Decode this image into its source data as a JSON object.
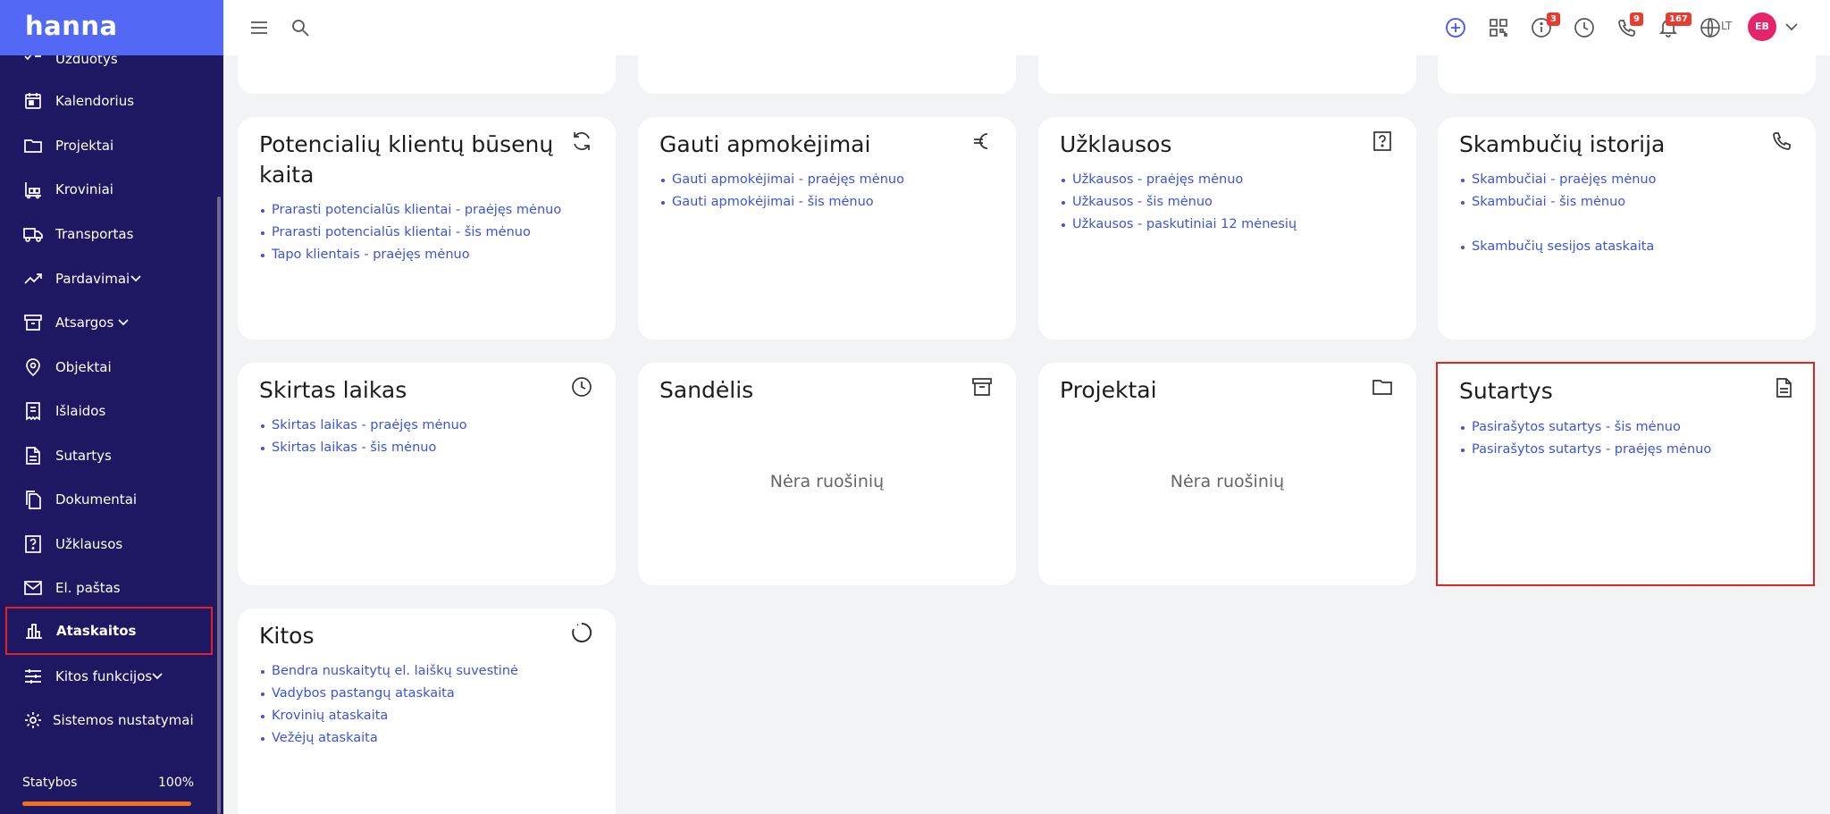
{
  "app": {
    "logo": "hanna"
  },
  "sidebar": {
    "items": [
      {
        "label": "Užduotys",
        "icon": "task-check-icon"
      },
      {
        "label": "Kalendorius",
        "icon": "calendar-icon"
      },
      {
        "label": "Projektai",
        "icon": "folder-icon"
      },
      {
        "label": "Kroviniai",
        "icon": "forklift-icon"
      },
      {
        "label": "Transportas",
        "icon": "truck-icon"
      },
      {
        "label": "Pardavimai",
        "icon": "trending-up-icon"
      },
      {
        "label": "Atsargos",
        "icon": "archive-icon"
      },
      {
        "label": "Objektai",
        "icon": "map-pin-icon"
      },
      {
        "label": "Išlaidos",
        "icon": "receipt-icon"
      },
      {
        "label": "Sutartys",
        "icon": "document-icon"
      },
      {
        "label": "Dokumentai",
        "icon": "files-icon"
      },
      {
        "label": "Užklausos",
        "icon": "question-box-icon"
      },
      {
        "label": "El. paštas",
        "icon": "mail-icon"
      },
      {
        "label": "Ataskaitos",
        "icon": "bar-chart-icon"
      },
      {
        "label": "Kitos funkcijos",
        "icon": "sliders-icon"
      },
      {
        "label": "Sistemos nustatymai",
        "icon": "gear-icon"
      }
    ],
    "progress": {
      "label": "Statybos",
      "value_text": "100%",
      "fraction": 1.0
    }
  },
  "header": {
    "badges": {
      "info": "3",
      "calls": "9",
      "notifications": "167"
    },
    "language": "LT",
    "avatar_initials": "EB"
  },
  "cards": {
    "potential_clients": {
      "title": "Potencialių klientų būsenų kaita",
      "links": [
        "Prarasti potencialūs klientai - praėjęs mėnuo",
        "Prarasti potencialūs klientai - šis mėnuo",
        "Tapo klientais - praėjęs mėnuo"
      ]
    },
    "payments": {
      "title": "Gauti apmokėjimai",
      "links": [
        "Gauti apmokėjimai - praėjęs mėnuo",
        "Gauti apmokėjimai - šis mėnuo"
      ]
    },
    "inquiries": {
      "title": "Užklausos",
      "links": [
        "Užkausos - praėjęs mėnuo",
        "Užkausos - šis mėnuo",
        "Užkausos - paskutiniai 12 mėnesių"
      ]
    },
    "calls": {
      "title": "Skambučių istorija",
      "links": [
        "Skambučiai - praėjęs mėnuo",
        "Skambučiai - šis mėnuo"
      ],
      "extra_link": "Skambučių sesijos ataskaita"
    },
    "time": {
      "title": "Skirtas laikas",
      "links": [
        "Skirtas laikas - praėjęs mėnuo",
        "Skirtas laikas - šis mėnuo"
      ]
    },
    "warehouse": {
      "title": "Sandėlis",
      "empty": "Nėra ruošinių"
    },
    "projects": {
      "title": "Projektai",
      "empty": "Nėra ruošinių"
    },
    "contracts": {
      "title": "Sutartys",
      "links": [
        "Pasirašytos sutartys - šis mėnuo",
        "Pasirašytos sutartys - praėjęs mėnuo"
      ]
    },
    "other": {
      "title": "Kitos",
      "links": [
        "Bendra nuskaitytų el. laiškų suvestinė",
        "Vadybos pastangų ataskaita",
        "Krovinių ataskaita",
        "Vežėjų ataskaita"
      ]
    }
  },
  "colors": {
    "sidebar": "#1e1863",
    "accent": "#5369f5",
    "link": "#3b55d6",
    "highlight": "#e02424",
    "progress": "#f26f21"
  }
}
